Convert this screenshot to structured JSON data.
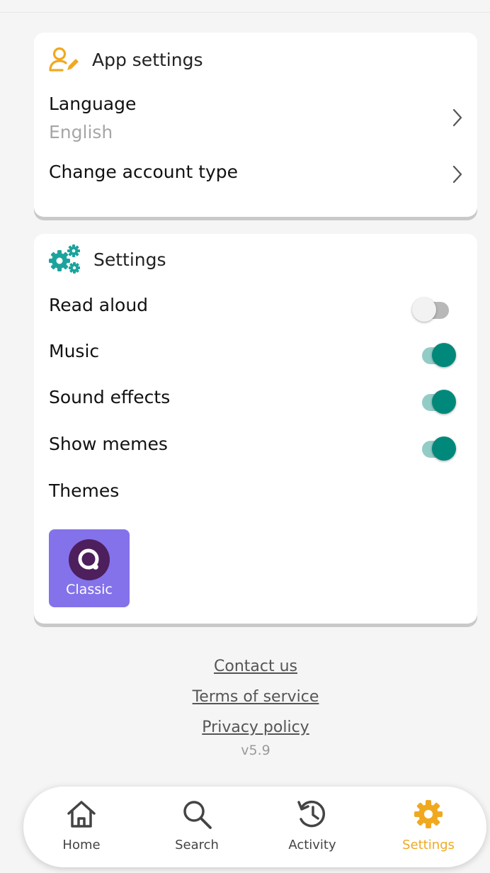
{
  "app_settings": {
    "title": "App settings",
    "language_label": "Language",
    "language_value": "English",
    "account_type_label": "Change account type"
  },
  "settings": {
    "title": "Settings",
    "read_aloud": {
      "label": "Read aloud",
      "enabled": false
    },
    "music": {
      "label": "Music",
      "enabled": true
    },
    "sound_effects": {
      "label": "Sound effects",
      "enabled": true
    },
    "show_memes": {
      "label": "Show memes",
      "enabled": true
    },
    "themes_label": "Themes",
    "theme_selected": "Classic"
  },
  "footer": {
    "contact": "Contact us",
    "terms": "Terms of service",
    "privacy": "Privacy policy",
    "version": "v5.9"
  },
  "nav": {
    "home": "Home",
    "search": "Search",
    "activity": "Activity",
    "settings": "Settings",
    "active": "Settings"
  },
  "colors": {
    "accent": "#f0a91f",
    "toggle_on": "#00897b",
    "theme_tile": "#8372ea",
    "settings_icon": "#1ba39c"
  }
}
